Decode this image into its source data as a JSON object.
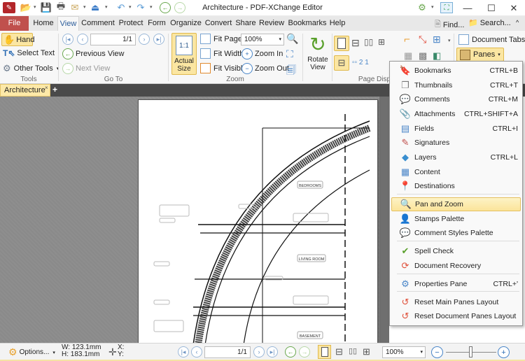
{
  "window": {
    "title": "Architecture - PDF-XChange Editor",
    "controls": {
      "minimize": "—",
      "maximize": "☐",
      "close": "✕"
    }
  },
  "quick_access": {
    "icons": [
      "app-logo-icon",
      "open-folder-icon",
      "save-icon",
      "print-icon",
      "email-icon",
      "scan-icon",
      "undo-icon",
      "redo-icon",
      "back-icon",
      "forward-icon"
    ]
  },
  "ribbon_tabs": [
    "File",
    "Home",
    "View",
    "Comment",
    "Protect",
    "Form",
    "Organize",
    "Convert",
    "Share",
    "Review",
    "Bookmarks",
    "Help"
  ],
  "active_tab": "View",
  "top_right": {
    "find": "Find...",
    "search": "Search..."
  },
  "ribbon": {
    "tools": {
      "label": "Tools",
      "hand": "Hand",
      "select_text": "Select Text",
      "other_tools": "Other Tools"
    },
    "goto": {
      "label": "Go To",
      "page_value": "1/1",
      "previous_view": "Previous View",
      "next_view": "Next View"
    },
    "zoom": {
      "label": "Zoom",
      "actual_size_line1": "Actual",
      "actual_size_line2": "Size",
      "fit_page": "Fit Page",
      "fit_width": "Fit Width",
      "fit_visible": "Fit Visible",
      "zoom_value": "100%",
      "zoom_in": "Zoom In",
      "zoom_out": "Zoom Out"
    },
    "rotate": {
      "line1": "Rotate",
      "line2": "View"
    },
    "page_display": {
      "label": "Page Disp"
    },
    "document_tabs": "Document Tabs",
    "panes": "Panes"
  },
  "document_tab": {
    "name": "Architecture",
    "close": "×",
    "add": "+"
  },
  "drawing": {
    "rooms": [
      "BEDROOMS",
      "LIVING ROOM",
      "BASEMENT"
    ]
  },
  "panes_menu": {
    "items": [
      {
        "label": "Bookmarks",
        "shortcut": "CTRL+B",
        "icon": "🔖"
      },
      {
        "label": "Thumbnails",
        "shortcut": "CTRL+T",
        "icon": "❐"
      },
      {
        "label": "Comments",
        "shortcut": "CTRL+M",
        "icon": "💬"
      },
      {
        "label": "Attachments",
        "shortcut": "CTRL+SHIFT+A",
        "icon": "📎"
      },
      {
        "label": "Fields",
        "shortcut": "CTRL+I",
        "icon": "▤"
      },
      {
        "label": "Signatures",
        "shortcut": "",
        "icon": "✎"
      },
      {
        "label": "Layers",
        "shortcut": "CTRL+L",
        "icon": "◆"
      },
      {
        "label": "Content",
        "shortcut": "",
        "icon": "▦"
      },
      {
        "label": "Destinations",
        "shortcut": "",
        "icon": "📍"
      },
      {
        "label": "Pan and Zoom",
        "shortcut": "",
        "icon": "🔍"
      },
      {
        "label": "Stamps Palette",
        "shortcut": "",
        "icon": "👤"
      },
      {
        "label": "Comment Styles Palette",
        "shortcut": "",
        "icon": "💬"
      },
      {
        "label": "Spell Check",
        "shortcut": "",
        "icon": "✔"
      },
      {
        "label": "Document Recovery",
        "shortcut": "",
        "icon": "⟳"
      },
      {
        "label": "Properties Pane",
        "shortcut": "CTRL+'",
        "icon": "⚙"
      },
      {
        "label": "Reset Main Panes Layout",
        "shortcut": "",
        "icon": "↺"
      },
      {
        "label": "Reset Document Panes Layout",
        "shortcut": "",
        "icon": "↺"
      }
    ],
    "highlighted": "Pan and Zoom"
  },
  "statusbar": {
    "options": "Options...",
    "width": "W: 123.1mm",
    "height": "H: 183.1mm",
    "x": "X:",
    "y": "Y:",
    "page_value": "1/1",
    "zoom_value": "100%",
    "zoom_slider_percent": 50
  }
}
